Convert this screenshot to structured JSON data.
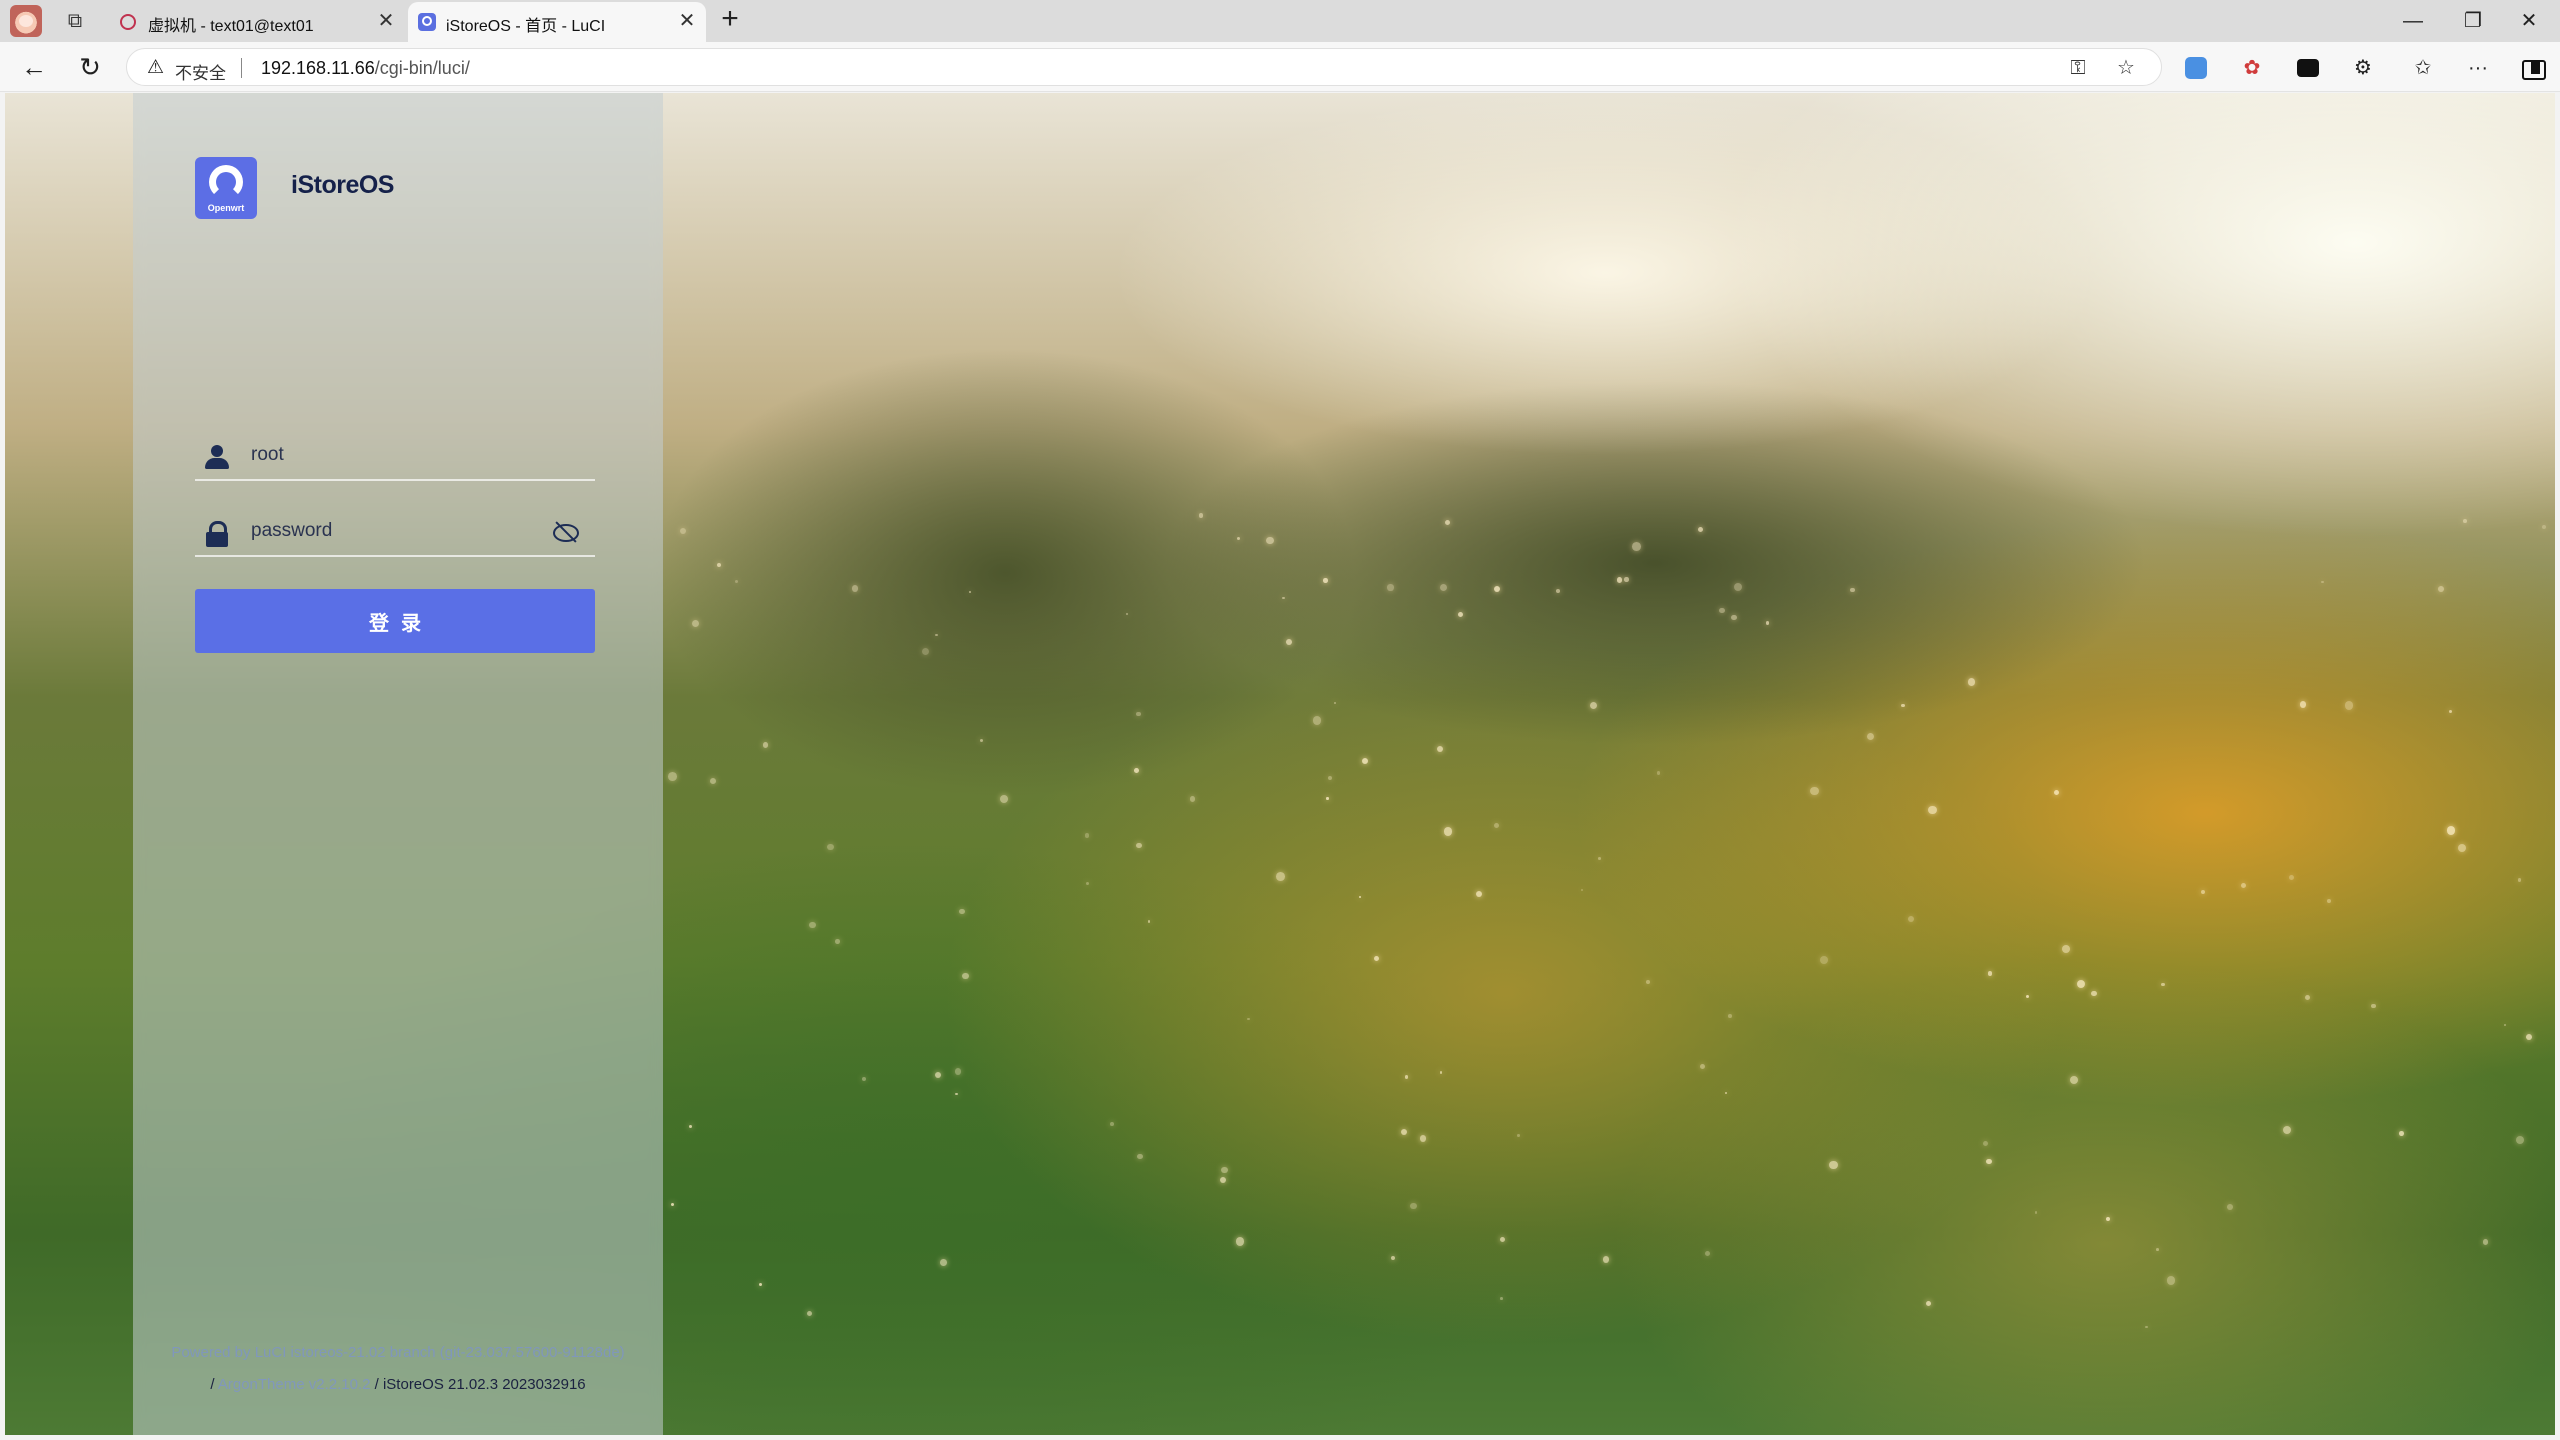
{
  "browser": {
    "tabs": [
      {
        "title": "虚拟机 - text01@text01",
        "active": false
      },
      {
        "title": "iStoreOS - 首页 - LuCI",
        "active": true
      }
    ],
    "new_tab_glyph": "+",
    "close_glyph": "✕",
    "window_controls": {
      "minimize": "—",
      "maximize": "❐",
      "close": "✕"
    },
    "nav": {
      "back": "←",
      "reload": "↻"
    },
    "security_label": "不安全",
    "url_host": "192.168.11.66",
    "url_path": "/cgi-bin/luci/",
    "icons": [
      "warning-icon",
      "key-icon",
      "star-icon",
      "extension-icon",
      "favorites-icon",
      "more-icon",
      "sidebar-icon"
    ]
  },
  "login": {
    "logo_caption": "Openwrt",
    "brand": "iStoreOS",
    "username_value": "root",
    "password_placeholder": "password",
    "submit_label": "登录",
    "accent_color": "#5a6fe6"
  },
  "footer": {
    "powered_by": "Powered by LuCI istoreos-21.02 branch (git-23.037.57600-91128de)",
    "sep1": "/",
    "theme": "ArgonTheme v2.2.10.2",
    "sep2": "/",
    "version": "iStoreOS 21.02.3 2023032916"
  }
}
